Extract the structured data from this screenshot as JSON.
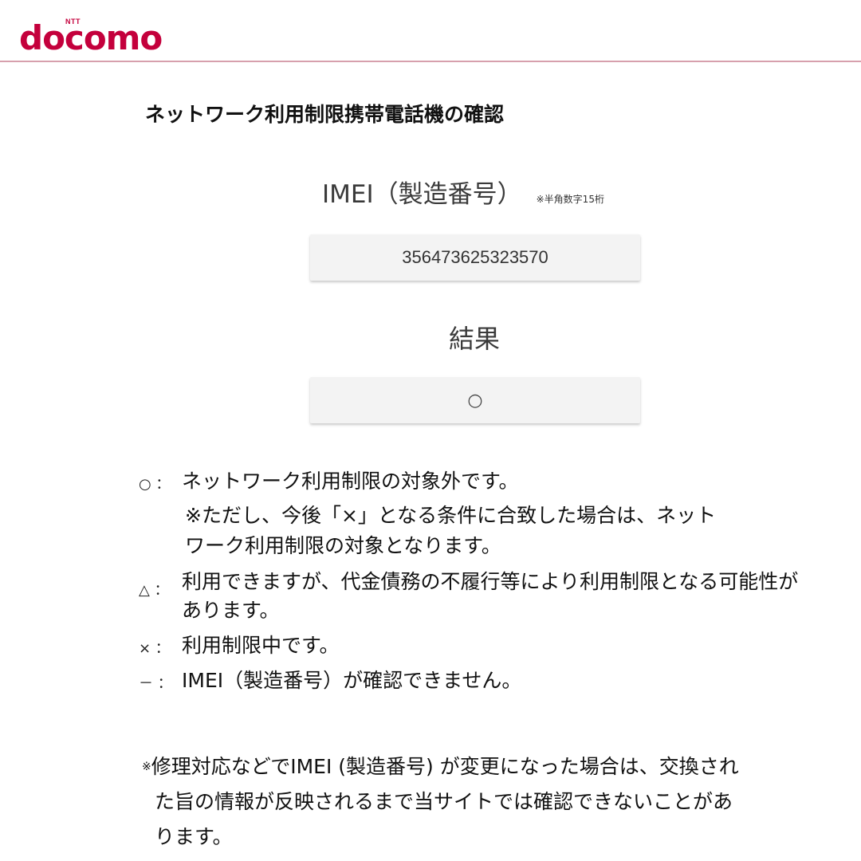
{
  "logo": {
    "ntt": "NTT",
    "brand": "docomo",
    "color": "#c4003c"
  },
  "page_title": "ネットワーク利用制限携帯電話機の確認",
  "imei": {
    "label": "IMEI（製造番号）",
    "note": "※半角数字15桁",
    "value": "356473625323570"
  },
  "result": {
    "label": "結果",
    "value": "○"
  },
  "legend": [
    {
      "symbol": "○ ：",
      "text": "ネットワーク利用制限の対象外です。",
      "sub": [
        "※ただし、今後「×」となる条件に合致した場合は、ネット",
        "ワーク利用制限の対象となります。"
      ]
    },
    {
      "symbol": "△ ：",
      "text": "利用できますが、代金債務の不履行等により利用制限となる可能性があります。"
    },
    {
      "symbol": "× ：",
      "text": "利用制限中です。"
    },
    {
      "symbol": "－ ：",
      "text": "IMEI（製造番号）が確認できません。"
    }
  ],
  "footnote": {
    "mark": "※",
    "line1": "修理対応などでIMEI (製造番号) が変更になった場合は、交換され",
    "line2": "た旨の情報が反映されるまで当サイトでは確認できないことがあ",
    "line3": "ります。"
  }
}
